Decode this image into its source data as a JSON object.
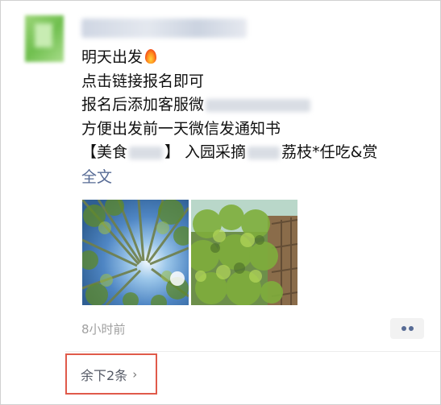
{
  "post": {
    "lines": [
      "明天出发",
      "点击链接报名即可",
      "报名后添加客服微",
      "方便出发前一天微信发通知书",
      "【美食",
      "】 入园采摘",
      "荔枝*任吃&赏"
    ],
    "fire_icon": "fire-emoji",
    "full_text_link": "全文",
    "timestamp": "8小时前",
    "more_icon": "two-dots-icon"
  },
  "footer": {
    "remaining_label": "余下2条",
    "chevron": "›"
  },
  "colors": {
    "link": "#576b95",
    "highlight_border": "#e05a4a",
    "timestamp": "#a0a0a0"
  }
}
